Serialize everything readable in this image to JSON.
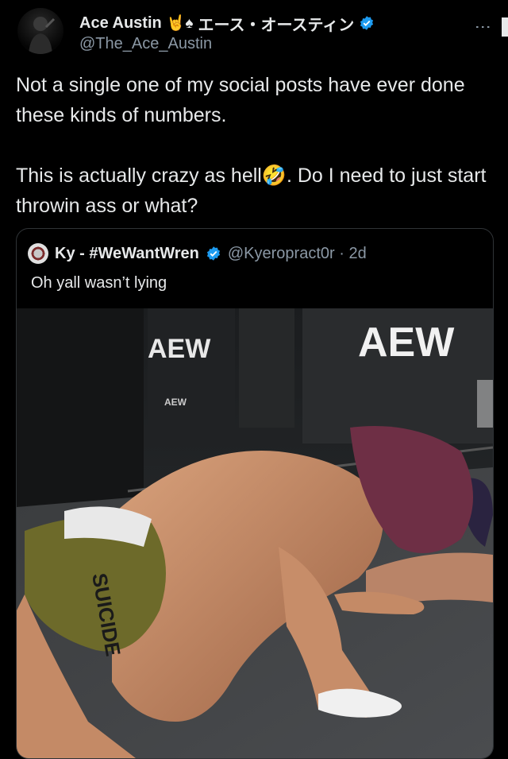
{
  "author": {
    "display_name": "Ace Austin",
    "emojis": "🤘♠",
    "japanese_name": "エース・オースティン",
    "handle": "@The_Ace_Austin",
    "verified": true
  },
  "tweet": {
    "paragraphs": [
      "Not a single one of my social posts have ever done these kinds of numbers.",
      "This is actually crazy as hell🤣. Do I need to just start throwin ass or what?"
    ]
  },
  "quoted": {
    "display_name": "Ky - #WeWantWren",
    "verified": true,
    "handle_time": "@Kyeropract0r · 2d",
    "text": "Oh yall wasn’t lying",
    "media": {
      "description_icon": "photo",
      "signage": [
        "AEW",
        "AEW",
        "AEW"
      ],
      "trunks_text": "SUICIDE"
    }
  },
  "colors": {
    "background": "#000000",
    "text": "#e7e9ea",
    "secondary": "#8b98a5",
    "verified": "#1d9bf0",
    "aew_gold": "#c9a24a"
  },
  "icons": {
    "more": "more-vertical-icon",
    "verified": "verified-badge-icon"
  }
}
